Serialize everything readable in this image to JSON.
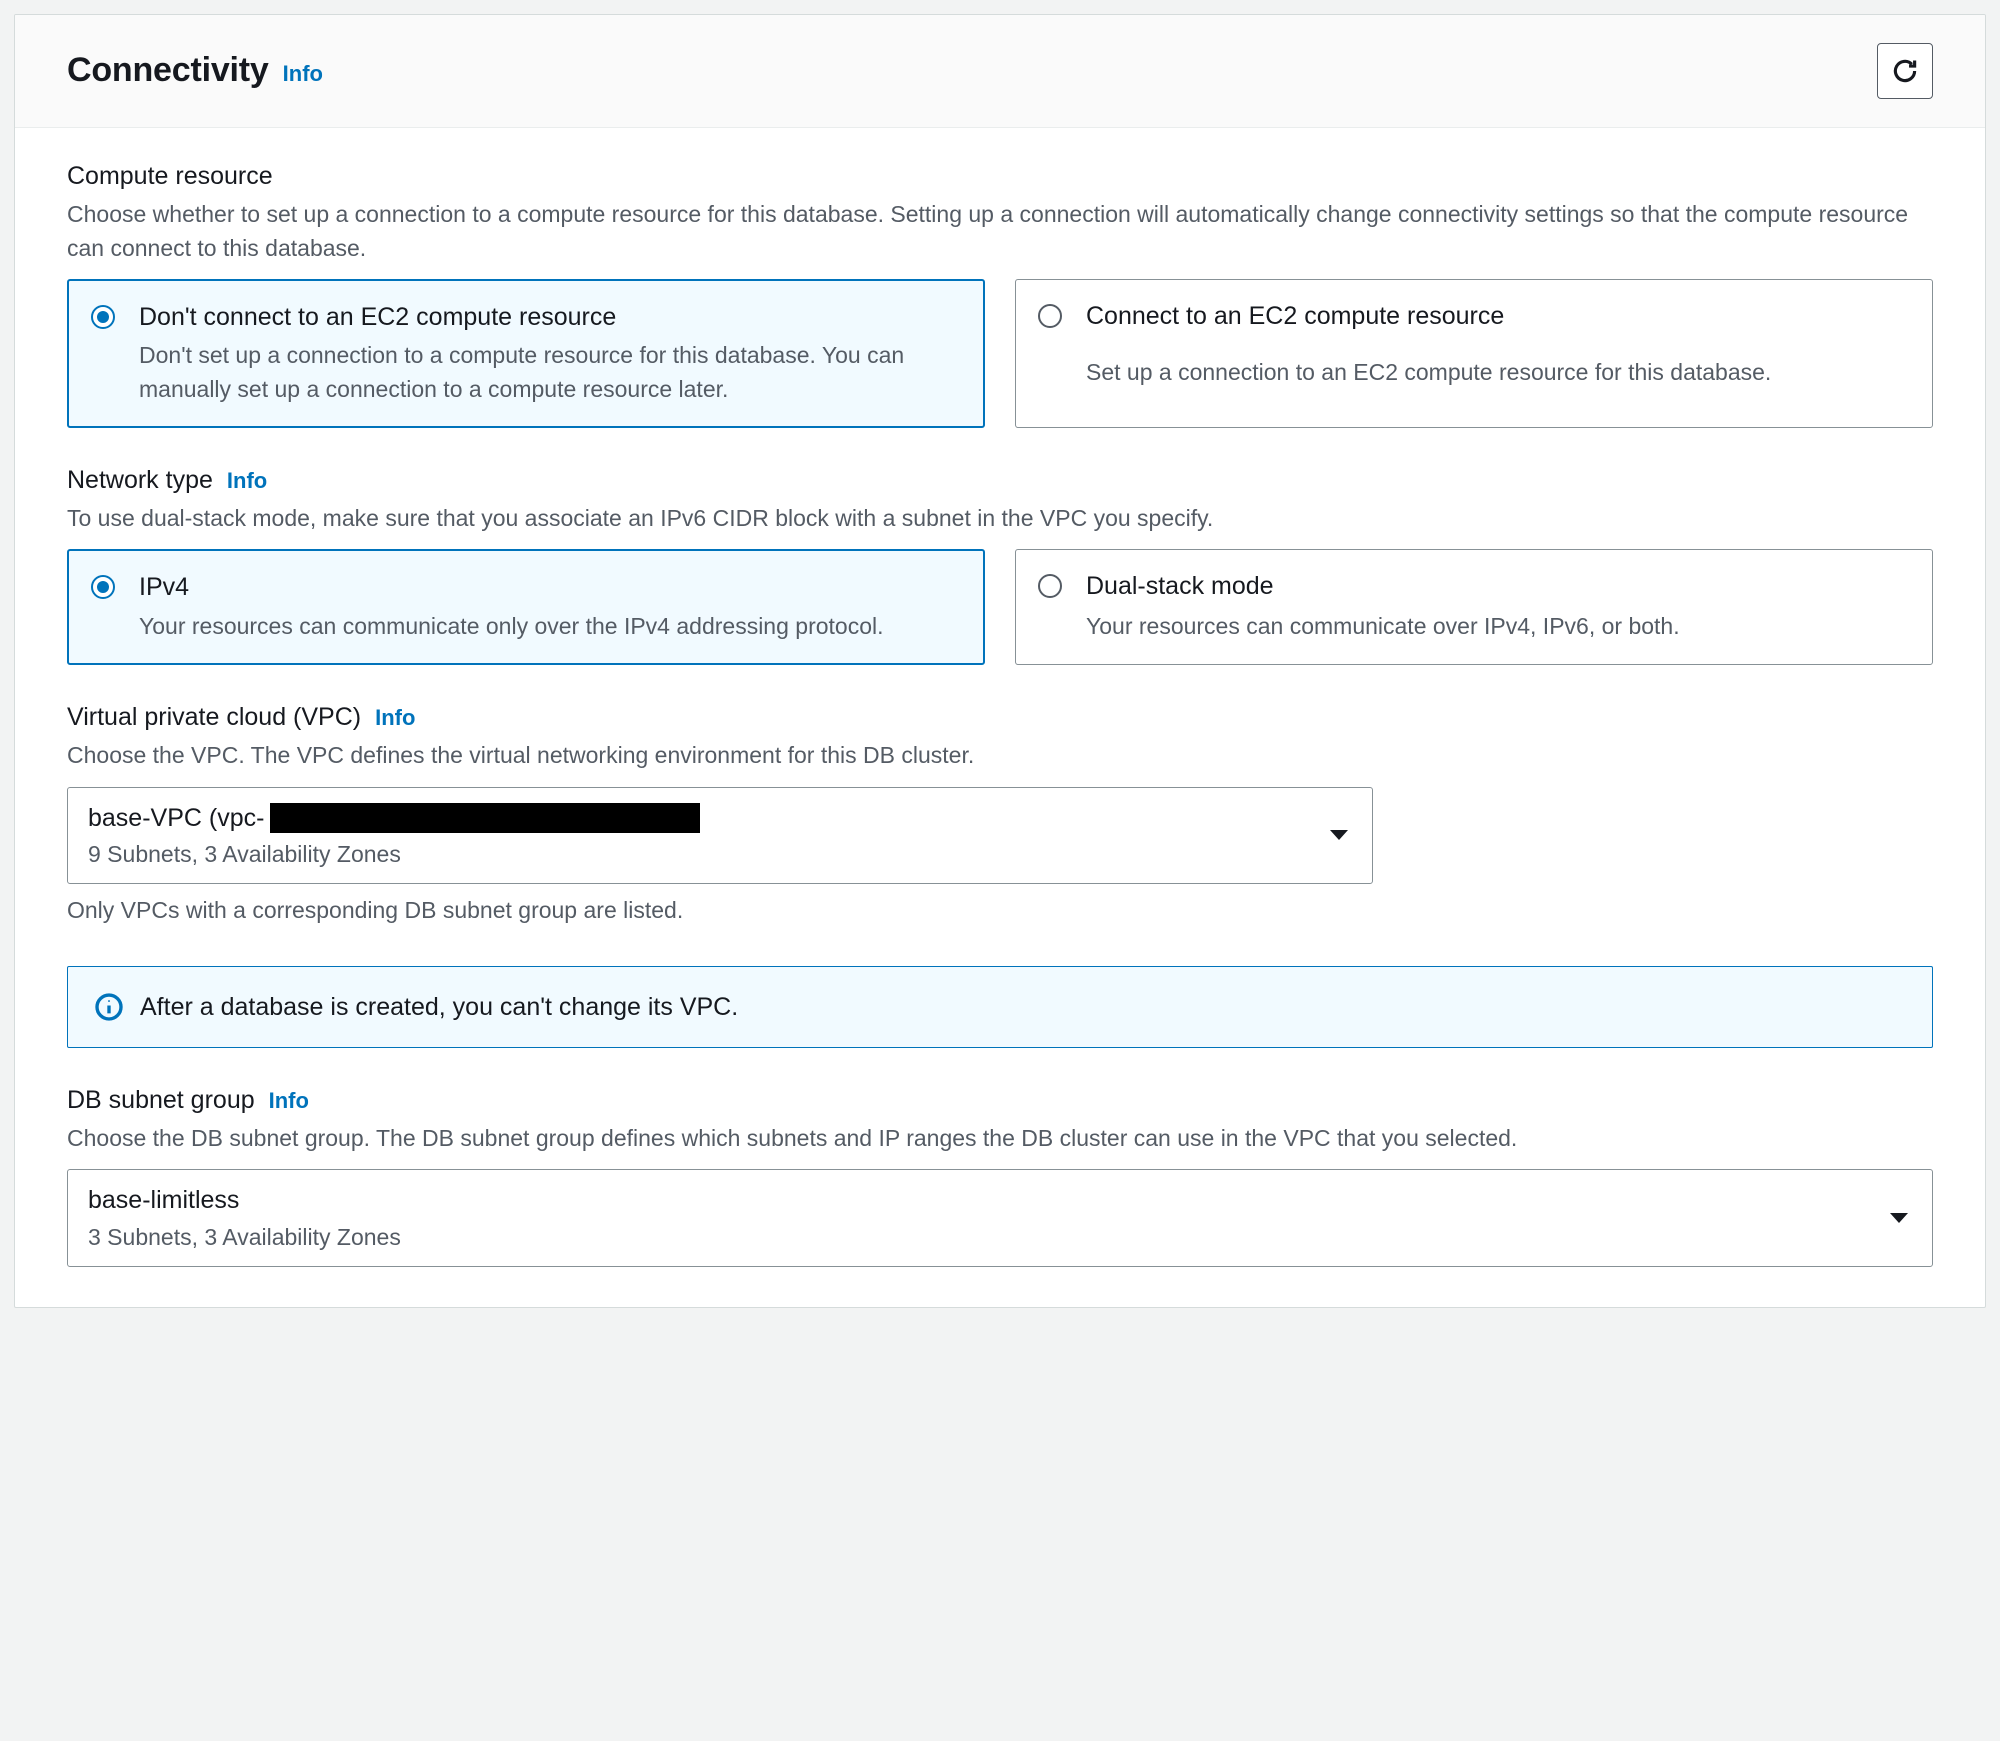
{
  "header": {
    "title": "Connectivity",
    "info_label": "Info"
  },
  "compute_resource": {
    "label": "Compute resource",
    "description": "Choose whether to set up a connection to a compute resource for this database. Setting up a connection will automatically change connectivity settings so that the compute resource can connect to this database.",
    "options": [
      {
        "title": "Don't connect to an EC2 compute resource",
        "description": "Don't set up a connection to a compute resource for this database. You can manually set up a connection to a compute resource later.",
        "selected": true
      },
      {
        "title": "Connect to an EC2 compute resource",
        "description": "Set up a connection to an EC2 compute resource for this database.",
        "selected": false
      }
    ]
  },
  "network_type": {
    "label": "Network type",
    "info_label": "Info",
    "description": "To use dual-stack mode, make sure that you associate an IPv6 CIDR block with a subnet in the VPC you specify.",
    "options": [
      {
        "title": "IPv4",
        "description": "Your resources can communicate only over the IPv4 addressing protocol.",
        "selected": true
      },
      {
        "title": "Dual-stack mode",
        "description": "Your resources can communicate over IPv4, IPv6, or both.",
        "selected": false
      }
    ]
  },
  "vpc": {
    "label": "Virtual private cloud (VPC)",
    "info_label": "Info",
    "description": "Choose the VPC. The VPC defines the virtual networking environment for this DB cluster.",
    "selected_prefix": "base-VPC (vpc-",
    "selected_sub": "9 Subnets, 3 Availability Zones",
    "helper": "Only VPCs with a corresponding DB subnet group are listed.",
    "alert": "After a database is created, you can't change its VPC."
  },
  "subnet_group": {
    "label": "DB subnet group",
    "info_label": "Info",
    "description": "Choose the DB subnet group. The DB subnet group defines which subnets and IP ranges the DB cluster can use in the VPC that you selected.",
    "selected": "base-limitless",
    "selected_sub": "3 Subnets, 3 Availability Zones"
  }
}
